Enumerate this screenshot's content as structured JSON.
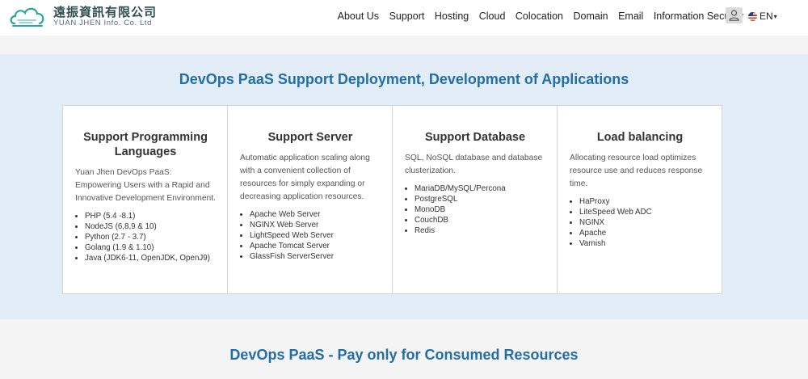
{
  "header": {
    "logo_cn": "遠振資訊有限公司",
    "logo_en": "YUAN JHEN Info. Co. Ltd",
    "nav": [
      "About Us",
      "Support",
      "Hosting",
      "Cloud",
      "Colocation",
      "Domain",
      "Email",
      "Information Security"
    ],
    "user_icon": "user-icon",
    "language": "EN"
  },
  "section1": {
    "title": "DevOps PaaS Support Deployment, Development of Applications",
    "cards": [
      {
        "title": "Support Programming Languages",
        "description": "Yuan Jhen DevOps PaaS: Empowering Users with a Rapid and Innovative Development Environment.",
        "items": [
          "PHP (5.4 -8.1)",
          "NodeJS (6,8,9 & 10)",
          "Python (2.7 - 3.7)",
          "Golang (1.9 & 1.10)",
          "Java (JDK6-11, OpenJDK, OpenJ9)"
        ]
      },
      {
        "title": "Support Server",
        "description": "Automatic application scaling along with a convenient collection of resources for simply expanding or decreasing application resources.",
        "items": [
          "Apache Web Server",
          "NGINX Web Server",
          "LightSpeed Web Server",
          "Apache Tomcat Server",
          "GlassFish ServerServer"
        ]
      },
      {
        "title": "Support Database",
        "description": "SQL, NoSQL database and database clusterization.",
        "items": [
          "MariaDB/MySQL/Percona",
          "PostgreSQL",
          "MonoDB",
          "CouchDB",
          "Redis"
        ]
      },
      {
        "title": "Load balancing",
        "description": "Allocating resource load optimizes resource use and reduces response time.",
        "items": [
          "HaProxy",
          "LiteSpeed Web ADC",
          "NGINX",
          "Apache",
          "Varnish"
        ]
      }
    ]
  },
  "section2": {
    "title": "DevOps PaaS - Pay only for Consumed Resources"
  },
  "colors": {
    "accent": "#226ea5",
    "band": "#e2edf8",
    "page": "#f4f4f4"
  }
}
